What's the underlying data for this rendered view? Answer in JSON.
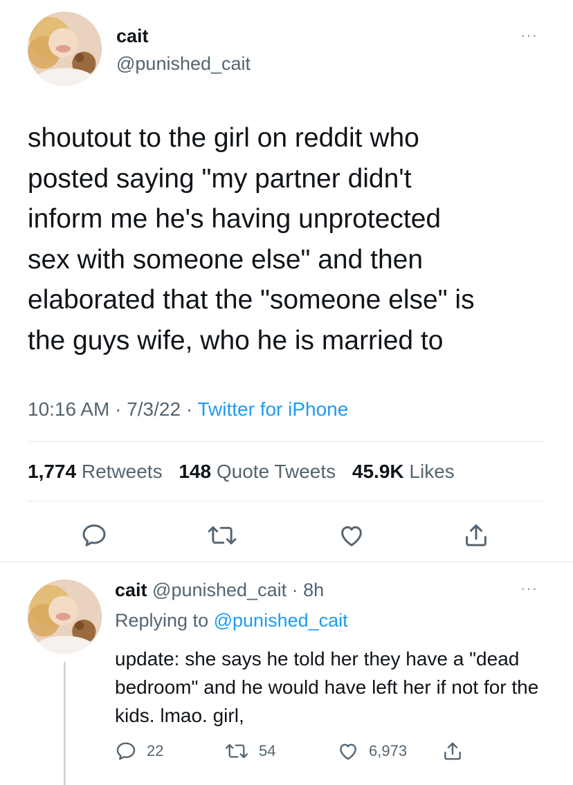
{
  "tweet": {
    "author_name": "cait",
    "author_handle": "@punished_cait",
    "text": "shoutout to the girl on reddit who\nposted saying \"my partner didn't\ninform me he's having unprotected\nsex with someone else\" and then\nelaborated that the \"someone else\" is\nthe guys wife, who he is married to",
    "time": "10:16 AM",
    "date": "7/3/22",
    "separator": "·",
    "source": "Twitter for iPhone",
    "stats": {
      "retweets_count": "1,774",
      "retweets_label": "Retweets",
      "quotes_count": "148",
      "quotes_label": "Quote Tweets",
      "likes_count": "45.9K",
      "likes_label": "Likes"
    },
    "more_glyph": "···"
  },
  "reply": {
    "author_name": "cait",
    "author_handle": "@punished_cait",
    "age": "8h",
    "separator": "·",
    "replying_prefix": "Replying to",
    "replying_handle": "@punished_cait",
    "text": "update: she says he told her they have a \"dead bedroom\" and he would have left her if not for the kids. lmao. girl,",
    "counts": {
      "replies": "22",
      "retweets": "54",
      "likes": "6,973"
    },
    "more_glyph": "···"
  },
  "icons": {
    "reply": "speech-bubble-icon",
    "retweet": "retweet-arrows-icon",
    "like": "heart-icon",
    "share": "share-upload-icon",
    "more": "more-dots-icon"
  },
  "colors": {
    "text": "#0f1419",
    "secondary": "#536471",
    "link": "#1d9bf0",
    "divider": "#e1e8ed"
  }
}
